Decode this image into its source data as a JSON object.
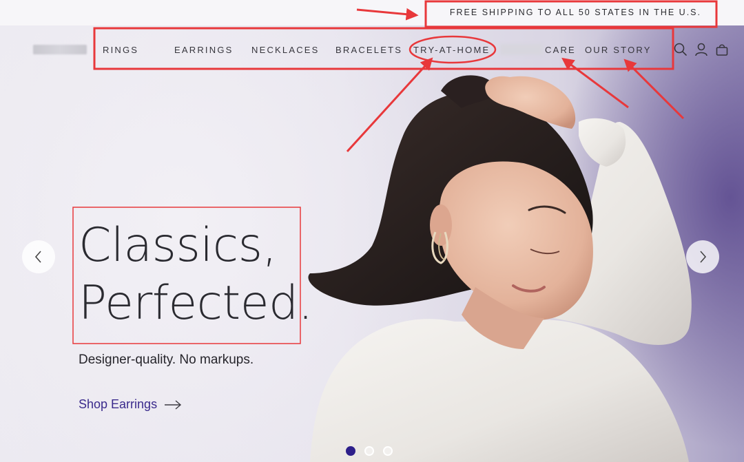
{
  "topbar": {
    "announcement": "FREE SHIPPING TO ALL 50 STATES IN THE U.S."
  },
  "nav": {
    "items": [
      {
        "label": "RINGS"
      },
      {
        "label": "EARRINGS"
      },
      {
        "label": "NECKLACES"
      },
      {
        "label": "BRACELETS"
      },
      {
        "label": "TRY-AT-HOME"
      },
      {
        "label": "CARE"
      },
      {
        "label": "OUR STORY"
      }
    ],
    "icons": [
      "search-icon",
      "account-icon",
      "bag-icon"
    ]
  },
  "hero": {
    "headline_line1": "Classics,",
    "headline_line2": "Perfected.",
    "subline": "Designer-quality. No markups.",
    "cta_label": "Shop Earrings",
    "slide_count": 3,
    "active_slide": 1
  },
  "colors": {
    "cta": "#3a2a8c",
    "active_dot": "#2d1f8a",
    "annotation": "#e8383b"
  }
}
